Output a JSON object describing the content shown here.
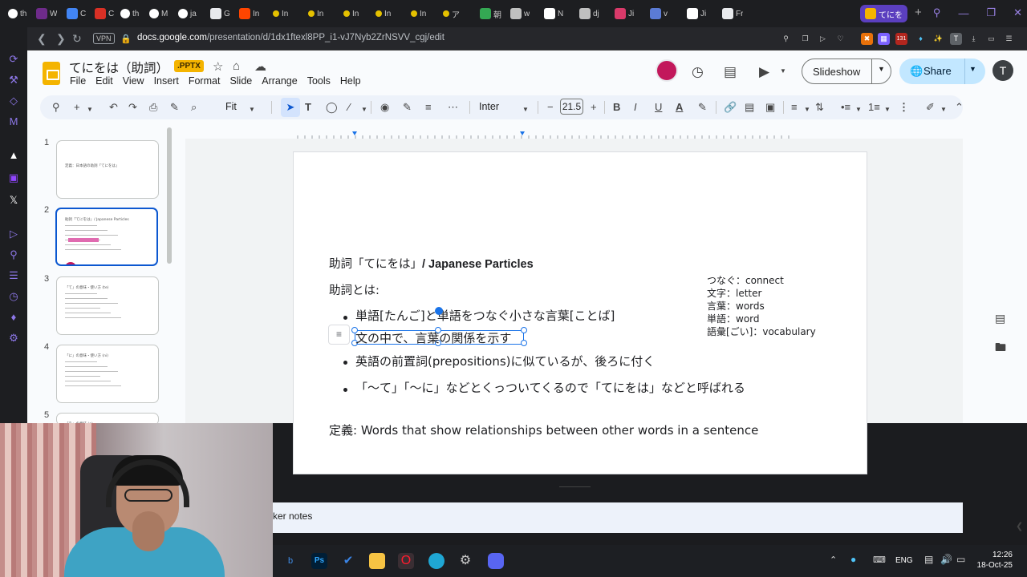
{
  "browser": {
    "tabs": [
      {
        "label": "th",
        "icon": "github-icon",
        "color": "#ffffff"
      },
      {
        "label": "W",
        "icon": "hi-icon",
        "color": "#6e2b8a"
      },
      {
        "label": "C",
        "icon": "docs-icon",
        "color": "#4285f4"
      },
      {
        "label": "C",
        "icon": "tk-icon",
        "color": "#d93025"
      },
      {
        "label": "th",
        "icon": "github-icon",
        "color": "#ffffff"
      },
      {
        "label": "M",
        "icon": "github-icon",
        "color": "#ffffff"
      },
      {
        "label": "ja",
        "icon": "google-icon",
        "color": "#ffffff"
      },
      {
        "label": "G",
        "icon": "gdoc-icon",
        "color": "#e8eaed"
      },
      {
        "label": "In",
        "icon": "reddit-icon",
        "color": "#ff4500"
      },
      {
        "label": "In",
        "icon": "dot-icon",
        "color": "#e5c100"
      },
      {
        "label": "In",
        "icon": "dot-icon",
        "color": "#e5c100"
      },
      {
        "label": "In",
        "icon": "dot-icon",
        "color": "#e5c100"
      },
      {
        "label": "In",
        "icon": "dot-icon",
        "color": "#e5c100"
      },
      {
        "label": "In",
        "icon": "dot-icon",
        "color": "#e5c100"
      },
      {
        "label": "ア",
        "icon": "dot-icon",
        "color": "#e5c100"
      },
      {
        "label": "朝",
        "icon": "sheet-icon",
        "color": "#34a853"
      },
      {
        "label": "w",
        "icon": "w-icon",
        "color": "#c0c0c0"
      },
      {
        "label": "N",
        "icon": "notion-icon",
        "color": "#ffffff"
      },
      {
        "label": "dj",
        "icon": "dj-icon",
        "color": "#c0c0c0"
      },
      {
        "label": "Ji",
        "icon": "ji-icon",
        "color": "#d93a6a"
      },
      {
        "label": "v",
        "icon": "m-icon",
        "color": "#5b7bd5"
      },
      {
        "label": "Ji",
        "icon": "wiki-icon",
        "color": "#ffffff"
      },
      {
        "label": "Fr",
        "icon": "fr-icon",
        "color": "#e8eaed"
      },
      {
        "label": "てにを",
        "icon": "slides-icon",
        "color": "#f4b400",
        "active": true
      }
    ],
    "new_tab": "+",
    "vpn": "VPN",
    "url_prefix": "docs.google.com",
    "url_rest": "/presentation/d/1dx1ftexl8PP_i1-vJ7Nyb2ZrNSVV_cgj/edit",
    "badge": "131",
    "profile_letter": "T"
  },
  "app": {
    "title": "てにをは（助詞）",
    "file_badge": ".PPTX",
    "menus": [
      "File",
      "Edit",
      "View",
      "Insert",
      "Format",
      "Slide",
      "Arrange",
      "Tools",
      "Help"
    ],
    "slideshow_label": "Slideshow",
    "share_label": "Share",
    "user_initial": "T",
    "zoom": "Fit",
    "font": "Inter",
    "font_size": "21.5"
  },
  "filmstrip": [
    {
      "num": "1",
      "preview": "定義：日本語の助詞「てにをは」"
    },
    {
      "num": "2",
      "preview": "助詞「てにをは」/ Japanese Particles",
      "selected": true
    },
    {
      "num": "3",
      "preview": "「て」の意味・使い方 (te)"
    },
    {
      "num": "4",
      "preview": "「に」の意味・使い方 (ni)"
    },
    {
      "num": "5",
      "preview": "「を」の意味 (o)"
    }
  ],
  "slide": {
    "title_jp": "助詞「てにをは」",
    "title_en": "/ Japanese Particles",
    "definition_label": "助詞とは:",
    "bullets": [
      "単語[たんご]と単語をつなぐ小さな言葉[ことば]",
      "文の中で、言葉の関係を示す",
      "英語の前置詞(prepositions)に似ているが、後ろに付く",
      "「〜て」「〜に」などとくっついてくるので「てにをは」などと呼ばれる"
    ],
    "glossary": [
      "つなぐ：connect",
      "文字：letter",
      "言葉：words",
      "単語：word",
      "語彙[ごい]：vocabulary"
    ],
    "definition_line": "定義: Words that show relationships between other words in a sentence"
  },
  "speaker_notes_label": "ker notes",
  "taskbar": {
    "apps": [
      "bing-icon",
      "photoshop-icon",
      "todo-icon",
      "explorer-icon",
      "opera-icon",
      "edge-icon",
      "chrome-icon",
      "discord-icon"
    ],
    "lang": "ENG",
    "time": "12:26",
    "date": "18-Oct-25"
  }
}
